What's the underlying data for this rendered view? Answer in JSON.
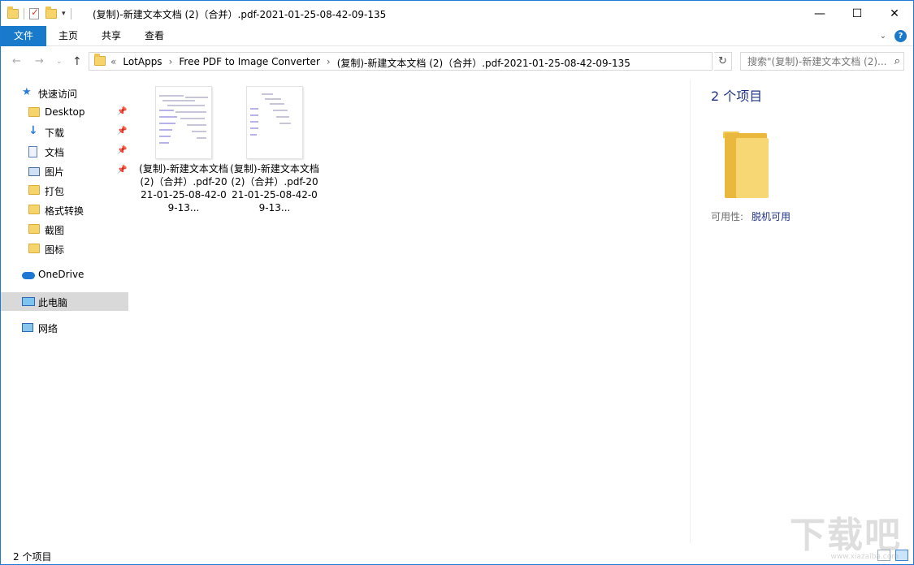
{
  "window": {
    "title": "(复制)-新建文本文档 (2)（合并）.pdf-2021-01-25-08-42-09-135",
    "minimize": "—",
    "maximize": "☐",
    "close": "✕"
  },
  "ribbon": {
    "tabs": [
      "文件",
      "主页",
      "共享",
      "查看"
    ],
    "expand": "⌄",
    "help": "?"
  },
  "address": {
    "lead": "«",
    "crumbs": [
      "LotApps",
      "Free PDF to Image Converter",
      "(复制)-新建文本文档 (2)（合并）.pdf-2021-01-25-08-42-09-135"
    ],
    "separator": "›",
    "search_placeholder": "搜索\"(复制)-新建文本文档 (2)...",
    "refresh": "↻",
    "dropdown": "⌄"
  },
  "nav": {
    "back": "←",
    "forward": "→",
    "recent": "⌄",
    "up": "↑"
  },
  "sidebar": {
    "quick_access": "快速访问",
    "items": [
      {
        "label": "Desktop",
        "icon": "folder-icon",
        "pinned": true
      },
      {
        "label": "下载",
        "icon": "download-icon",
        "pinned": true
      },
      {
        "label": "文档",
        "icon": "document-icon",
        "pinned": true
      },
      {
        "label": "图片",
        "icon": "picture-icon",
        "pinned": true
      },
      {
        "label": "打包",
        "icon": "folder-icon",
        "pinned": false
      },
      {
        "label": "格式转换",
        "icon": "folder-icon",
        "pinned": false
      },
      {
        "label": "截图",
        "icon": "folder-icon",
        "pinned": false
      },
      {
        "label": "图标",
        "icon": "folder-icon",
        "pinned": false
      }
    ],
    "onedrive": "OneDrive",
    "this_pc": "此电脑",
    "network": "网络"
  },
  "files": [
    {
      "name": "(复制)-新建文本文档 (2)（合并）.pdf-2021-01-25-08-42-09-13..."
    },
    {
      "name": "(复制)-新建文本文档 (2)（合并）.pdf-2021-01-25-08-42-09-13..."
    }
  ],
  "details": {
    "count": "2 个项目",
    "availability_label": "可用性:",
    "availability_value": "脱机可用"
  },
  "status": {
    "count": "2 个项目"
  },
  "watermark": {
    "text": "下载吧",
    "sub": "www.xiazaiba.com"
  }
}
